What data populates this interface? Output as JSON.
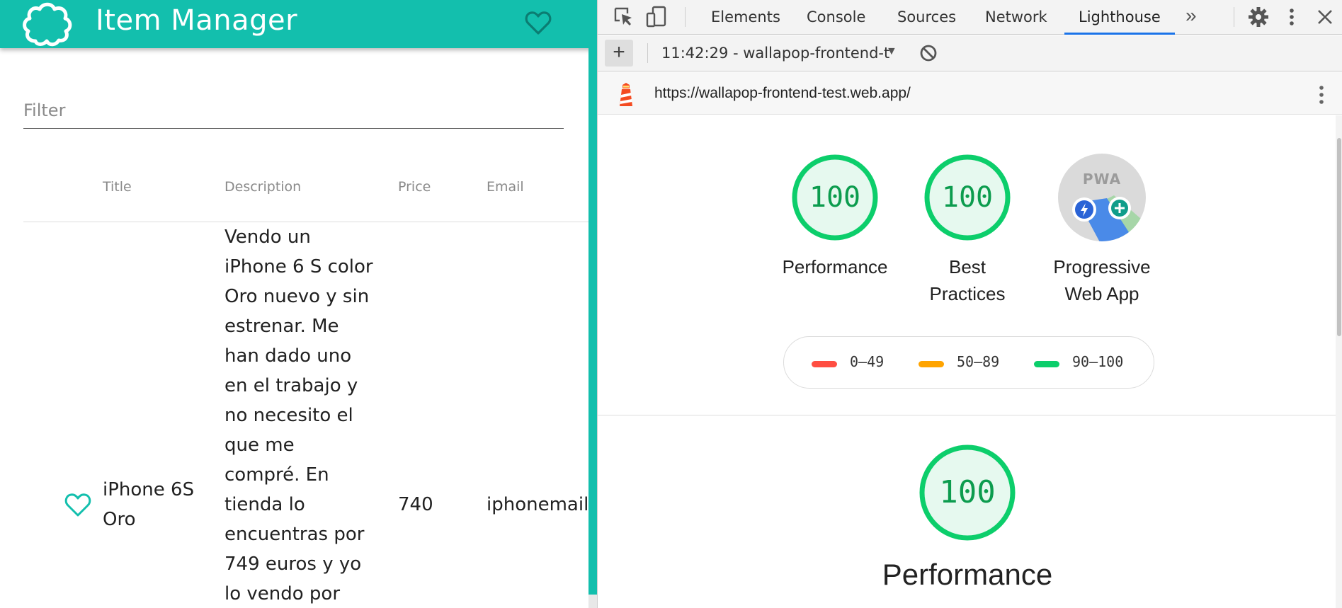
{
  "app": {
    "title": "Item Manager",
    "filter_placeholder": "Filter",
    "columns": [
      "Title",
      "Description",
      "Price",
      "Email"
    ],
    "row": {
      "title": "iPhone 6S Oro",
      "description_lines": [
        "Vendo un",
        "iPhone 6 S color",
        "Oro nuevo y sin",
        "estrenar. Me",
        "han dado uno",
        "en el trabajo y",
        "no necesito el",
        "que me",
        "compré. En",
        "tienda lo",
        "encuentras por",
        "749 euros y yo",
        "lo vendo por"
      ],
      "price": "740",
      "email": "iphonemail@wallapop.com"
    },
    "colors": {
      "brand": "#13bfad"
    }
  },
  "devtools": {
    "tabs": [
      "Elements",
      "Console",
      "Sources",
      "Network",
      "Lighthouse"
    ],
    "active_tab": "Lighthouse",
    "report_select": "11:42:29 - wallapop-frontend-t",
    "url": "https://wallapop-frontend-test.web.app/",
    "icons": [
      "inspect-icon",
      "device-toggle-icon",
      "more-tabs-icon",
      "settings-gear-icon",
      "kebab-menu-icon",
      "close-icon"
    ]
  },
  "lighthouse": {
    "gauges": [
      {
        "score": "100",
        "label_lines": [
          "Performance"
        ]
      },
      {
        "score": "100",
        "label_lines": [
          "Best",
          "Practices"
        ]
      },
      {
        "label_lines": [
          "Progressive",
          "Web App"
        ],
        "badge": "PWA"
      }
    ],
    "legend": [
      {
        "range": "0–49",
        "color": "#ff4e42"
      },
      {
        "range": "50–89",
        "color": "#ffa400"
      },
      {
        "range": "90–100",
        "color": "#0cce6b"
      }
    ],
    "detail": {
      "score": "100",
      "title": "Performance"
    },
    "colors": {
      "pass": "#0cce6b",
      "pass_text": "#0c9c4e",
      "pass_fill": "#e6f9ef"
    }
  }
}
